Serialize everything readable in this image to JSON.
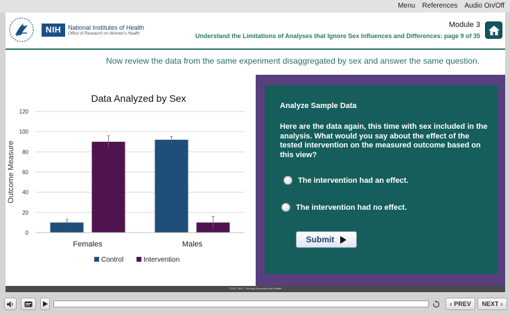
{
  "top_menu": {
    "items": [
      "Menu",
      "References",
      "Audio On/Off"
    ]
  },
  "header": {
    "logo_box": "NIH",
    "org_name": "National Institutes of Health",
    "org_sub": "Office of Research on Women's Health",
    "module": "Module 3",
    "subtitle": "Understand the Limitations of Analyses that Ignore Sex Influences and Differences: page 9 of 35",
    "home_icon": "home-icon"
  },
  "prompt": "Now review the data from the same experiment disaggregated by sex and answer the same question.",
  "chart_data": {
    "type": "bar",
    "title": "Data Analyzed by Sex",
    "ylabel": "Outcome Measure",
    "xlabel": "",
    "ylim": [
      0,
      120
    ],
    "yticks": [
      0,
      20,
      40,
      60,
      80,
      100,
      120
    ],
    "grid": true,
    "legend_position": "bottom",
    "categories": [
      "Females",
      "Males"
    ],
    "series": [
      {
        "name": "Control",
        "color": "#1f4e79",
        "values": [
          10,
          92
        ],
        "errors": [
          3,
          3
        ]
      },
      {
        "name": "Intervention",
        "color": "#4f1450",
        "values": [
          90,
          10
        ],
        "errors": [
          6,
          6
        ]
      }
    ]
  },
  "quiz": {
    "title": "Analyze Sample Data",
    "question": "Here are the data again, this time with sex included in the analysis. What would you say about the effect of the tested intervention on the measured outcome based on this view?",
    "options": [
      "The intervention had an effect.",
      "The intervention had no effect."
    ],
    "submit_label": "Submit"
  },
  "footer": {
    "copyright": "©2017 NIH...Turning Discovery Into Health"
  },
  "controls": {
    "prev_label": "PREV",
    "next_label": "NEXT"
  }
}
